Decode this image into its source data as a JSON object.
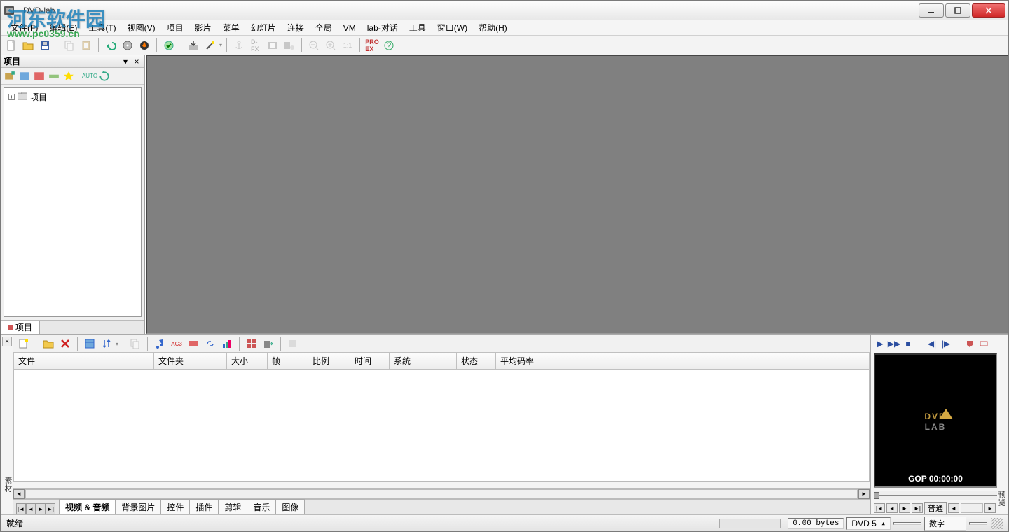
{
  "app": {
    "title": "DVD-lab"
  },
  "watermark": {
    "text": "河东软件园",
    "url": "www.pc0359.cn"
  },
  "menu": {
    "file": "文件(F)",
    "edit": "编辑(E)",
    "tools": "工具(T)",
    "view": "视图(V)",
    "project": "项目",
    "movie": "影片",
    "menu_item": "菜单",
    "slideshow": "幻灯片",
    "connection": "连接",
    "global": "全局",
    "vm": "VM",
    "lab_dialog": "lab-对话",
    "tool2": "工具",
    "window": "窗口(W)",
    "help": "帮助(H)"
  },
  "toolbar_labels": {
    "one_one": "1:1",
    "dfx": "D-FX",
    "proex": "PRO EX"
  },
  "project_panel": {
    "title": "项目",
    "root": "项目",
    "tab": "项目"
  },
  "assets": {
    "columns": [
      "文件",
      "文件夹",
      "大小",
      "帧",
      "比例",
      "时间",
      "系统",
      "状态",
      "平均码率"
    ],
    "tabs": [
      "视频 & 音频",
      "背景图片",
      "控件",
      "插件",
      "剪辑",
      "音乐",
      "图像"
    ],
    "sidebar_label": "素材"
  },
  "preview": {
    "sidebar_label": "预览",
    "logo": "DVD LAB",
    "gop": "GOP 00:00:00",
    "nav_label": "普通"
  },
  "status": {
    "ready": "就绪",
    "bytes": "0.00 bytes",
    "dvd": "DVD 5",
    "digits": "数字"
  }
}
